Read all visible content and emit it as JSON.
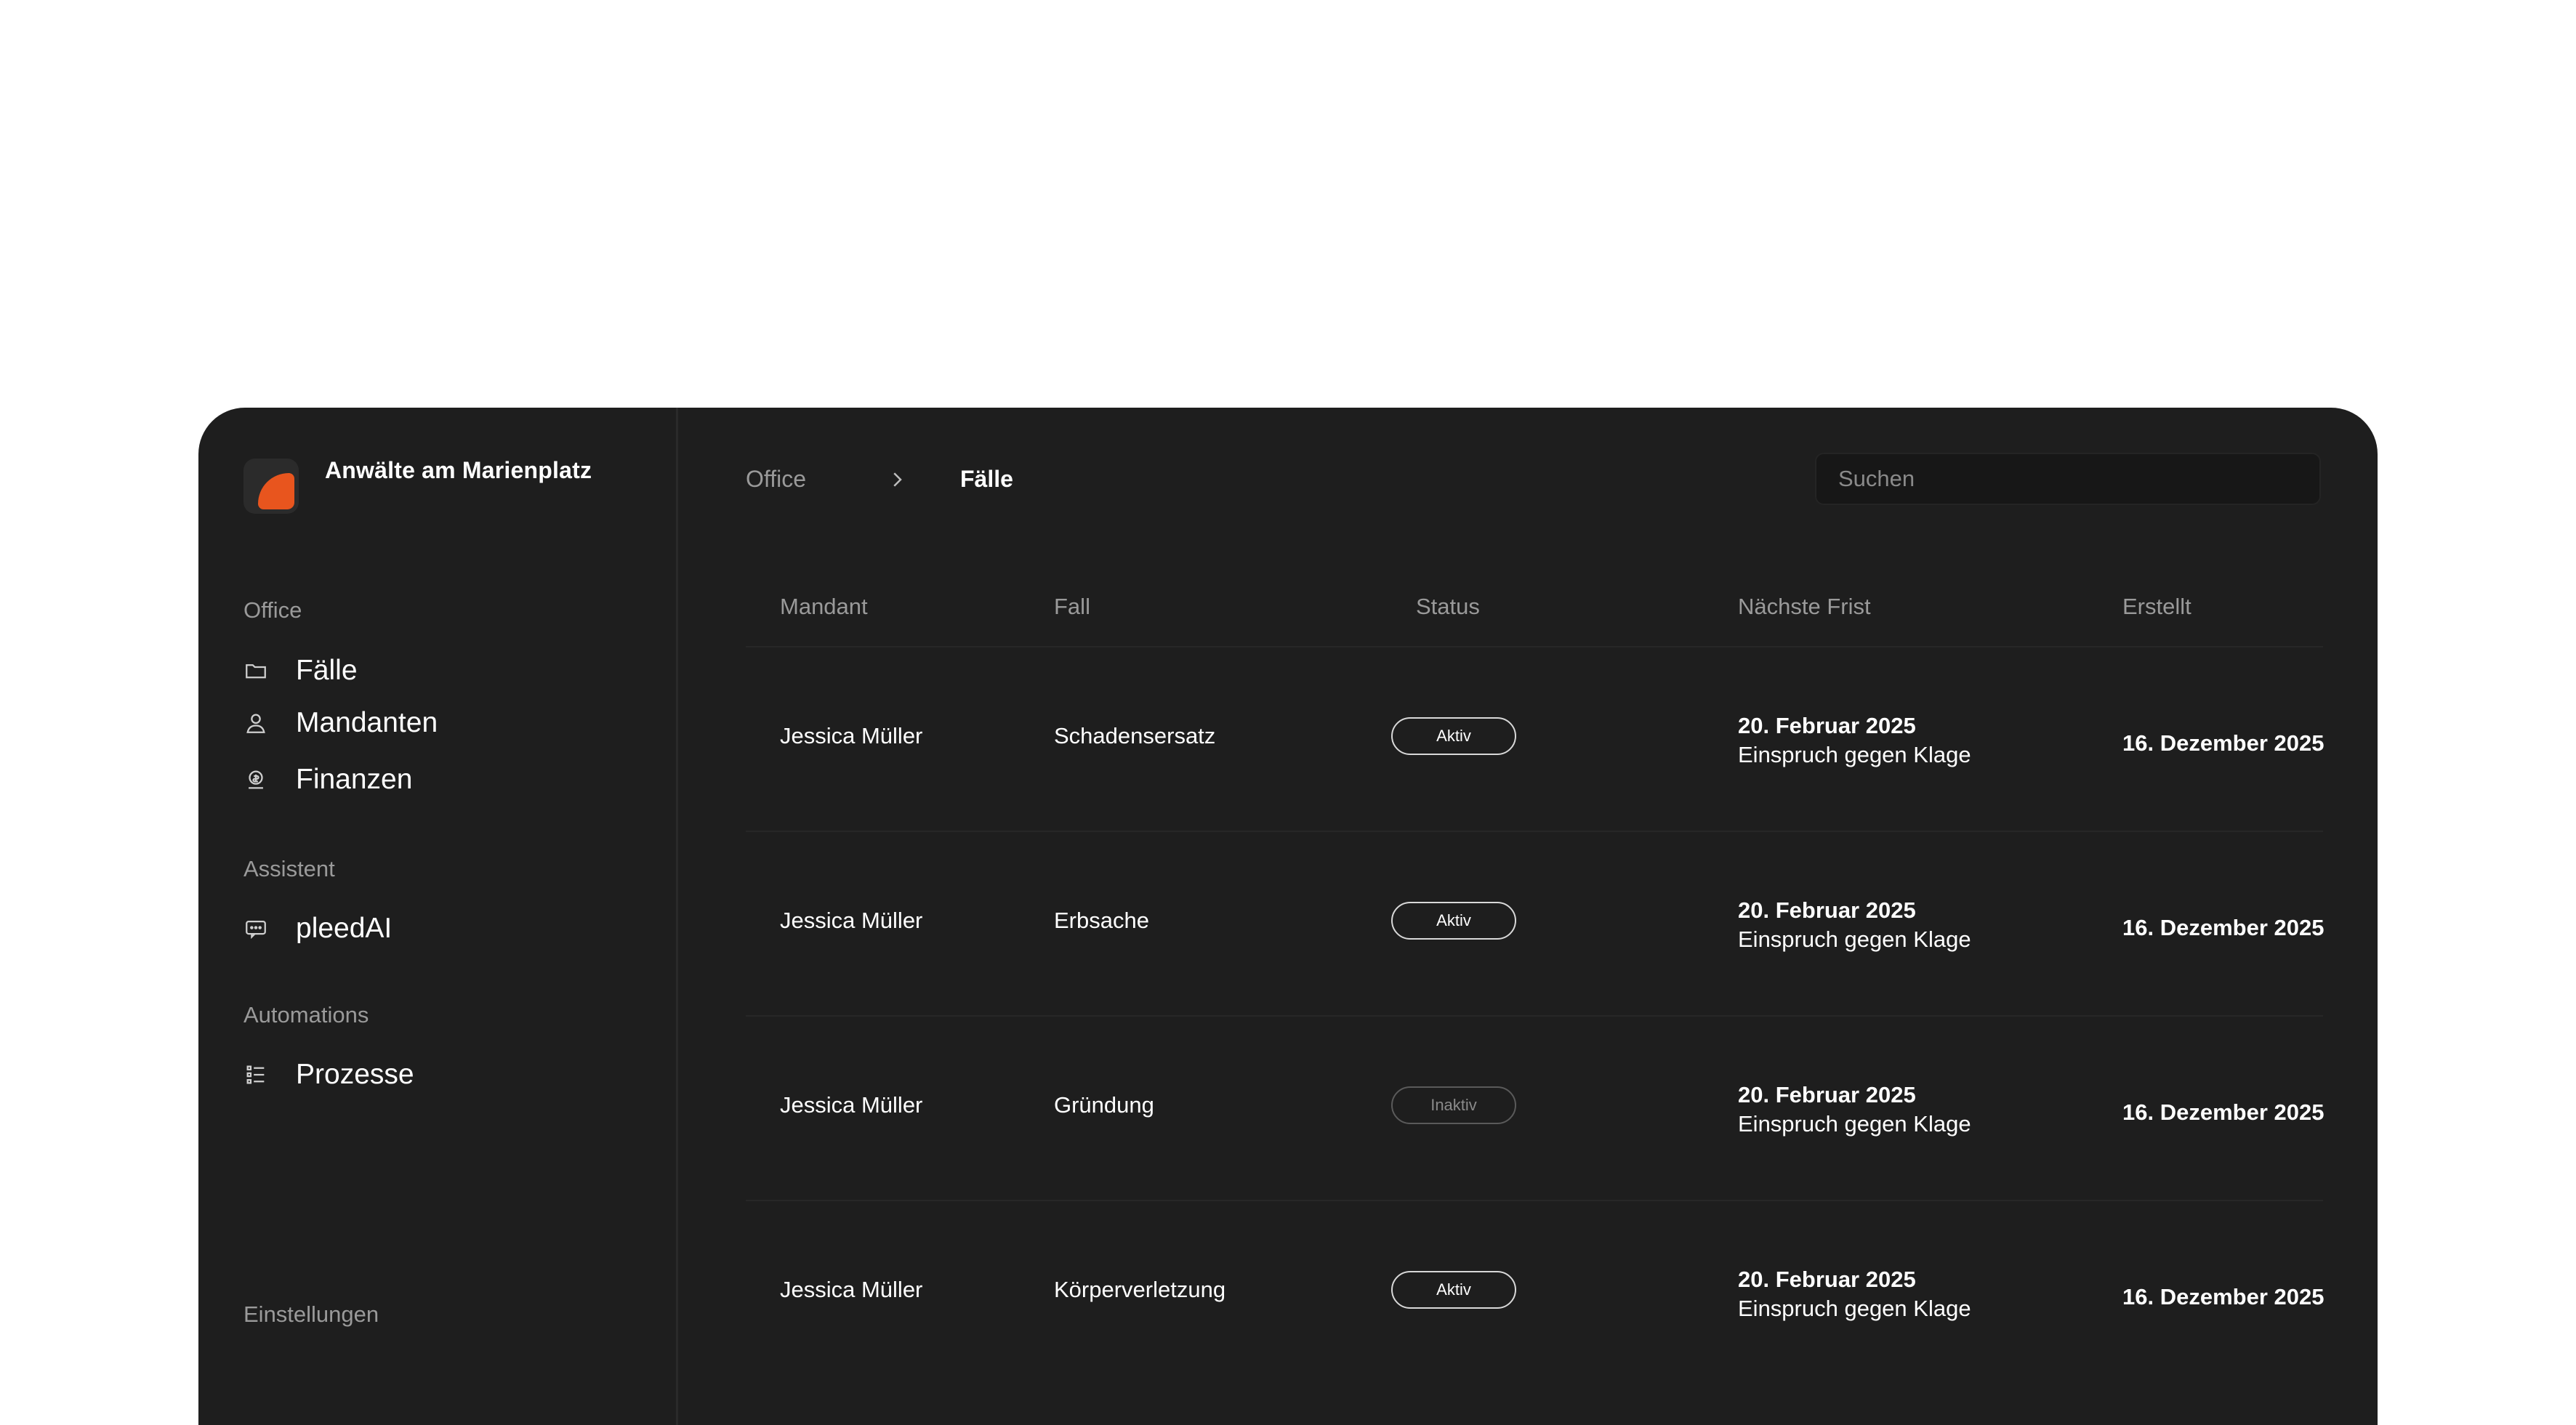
{
  "brand": {
    "name": "Anwälte am Marienplatz"
  },
  "sidebar": {
    "sections": [
      {
        "label": "Office"
      },
      {
        "label": "Assistent"
      },
      {
        "label": "Automations"
      }
    ],
    "items": [
      {
        "label": "Fälle",
        "icon": "folder-icon"
      },
      {
        "label": "Mandanten",
        "icon": "user-icon"
      },
      {
        "label": "Finanzen",
        "icon": "coin-icon"
      },
      {
        "label": "pleedAI",
        "icon": "chat-icon"
      },
      {
        "label": "Prozesse",
        "icon": "process-list-icon"
      }
    ],
    "settings_label": "Einstellungen"
  },
  "breadcrumb": {
    "root": "Office",
    "current": "Fälle"
  },
  "search": {
    "placeholder": "Suchen"
  },
  "table": {
    "columns": [
      "Mandant",
      "Fall",
      "Status",
      "Nächste Frist",
      "Erstellt"
    ],
    "rows": [
      {
        "mandant": "Jessica Müller",
        "fall": "Schadensersatz",
        "status": "Aktiv",
        "frist_date": "20. Februar 2025",
        "frist_desc": "Einspruch gegen Klage",
        "erstellt": "16. Dezember 2025"
      },
      {
        "mandant": "Jessica Müller",
        "fall": "Erbsache",
        "status": "Aktiv",
        "frist_date": "20. Februar 2025",
        "frist_desc": "Einspruch gegen Klage",
        "erstellt": "16. Dezember 2025"
      },
      {
        "mandant": "Jessica Müller",
        "fall": "Gründung",
        "status": "Inaktiv",
        "frist_date": "20. Februar 2025",
        "frist_desc": "Einspruch gegen Klage",
        "erstellt": "16. Dezember 2025"
      },
      {
        "mandant": "Jessica Müller",
        "fall": "Körperverletzung",
        "status": "Aktiv",
        "frist_date": "20. Februar 2025",
        "frist_desc": "Einspruch gegen Klage",
        "erstellt": "16. Dezember 2025"
      }
    ]
  },
  "colors": {
    "accent": "#e8551e",
    "panel": "#1e1e1e",
    "muted_text": "#9a9a9a"
  }
}
